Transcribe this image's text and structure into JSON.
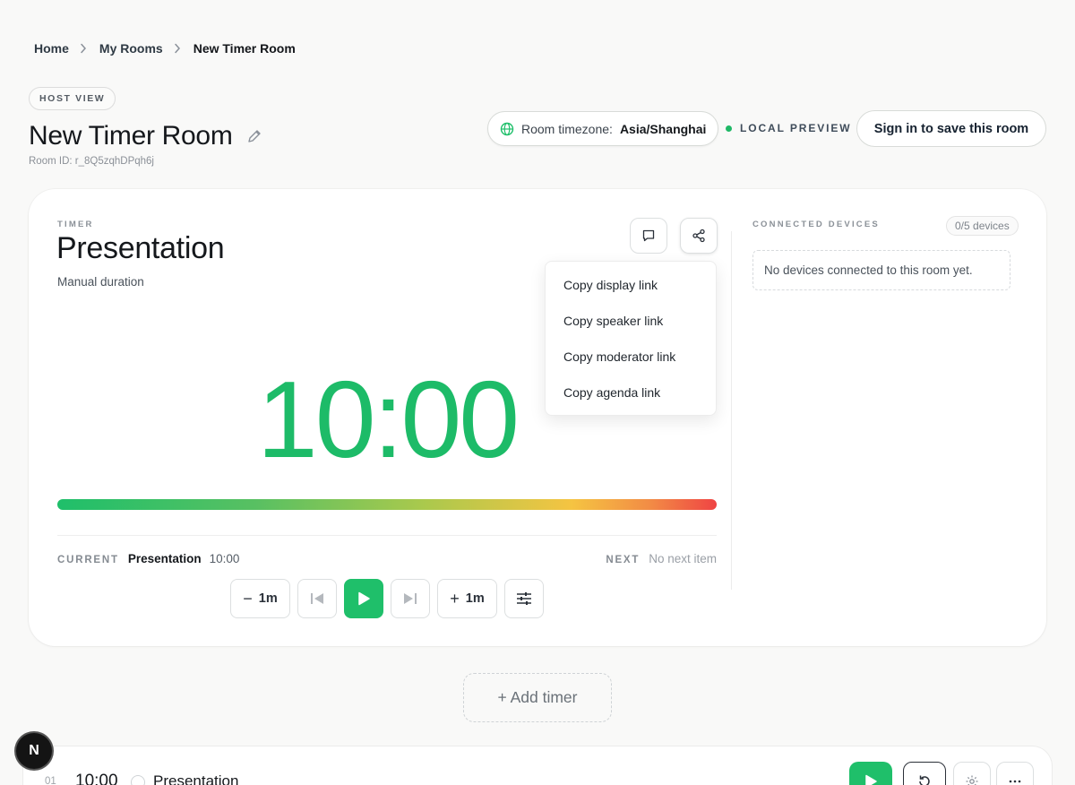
{
  "breadcrumb": {
    "home": "Home",
    "rooms": "My Rooms",
    "current": "New Timer Room"
  },
  "header": {
    "badge": "HOST VIEW",
    "title": "New Timer Room",
    "room_id": "Room ID: r_8Q5zqhDPqh6j",
    "timezone_label": "Room timezone:",
    "timezone_value": "Asia/Shanghai",
    "preview_label": "LOCAL PREVIEW",
    "signin_label": "Sign in to save this room"
  },
  "timer": {
    "section_label": "TIMER",
    "title": "Presentation",
    "subtitle": "Manual duration",
    "display_time": "10:00",
    "progress_fraction": 1.0,
    "current_label": "CURRENT",
    "current_name": "Presentation",
    "current_time": "10:00",
    "next_label": "NEXT",
    "next_value": "No next item"
  },
  "controls": {
    "minus_label": "1m",
    "plus_label": "1m"
  },
  "share_menu": [
    "Copy display link",
    "Copy speaker link",
    "Copy moderator link",
    "Copy agenda link"
  ],
  "devices": {
    "section_label": "CONNECTED DEVICES",
    "count": "0/5 devices",
    "empty_message": "No devices connected to this room yet."
  },
  "add_timer_label": "+ Add timer",
  "timer_list": [
    {
      "index": "01",
      "time": "10:00",
      "name": "Presentation"
    }
  ],
  "badge_letter": "N",
  "colors": {
    "accent": "#1fbf6a",
    "timer_text": "#1dbb68",
    "danger": "#ef4444",
    "warning": "#f5c442"
  }
}
